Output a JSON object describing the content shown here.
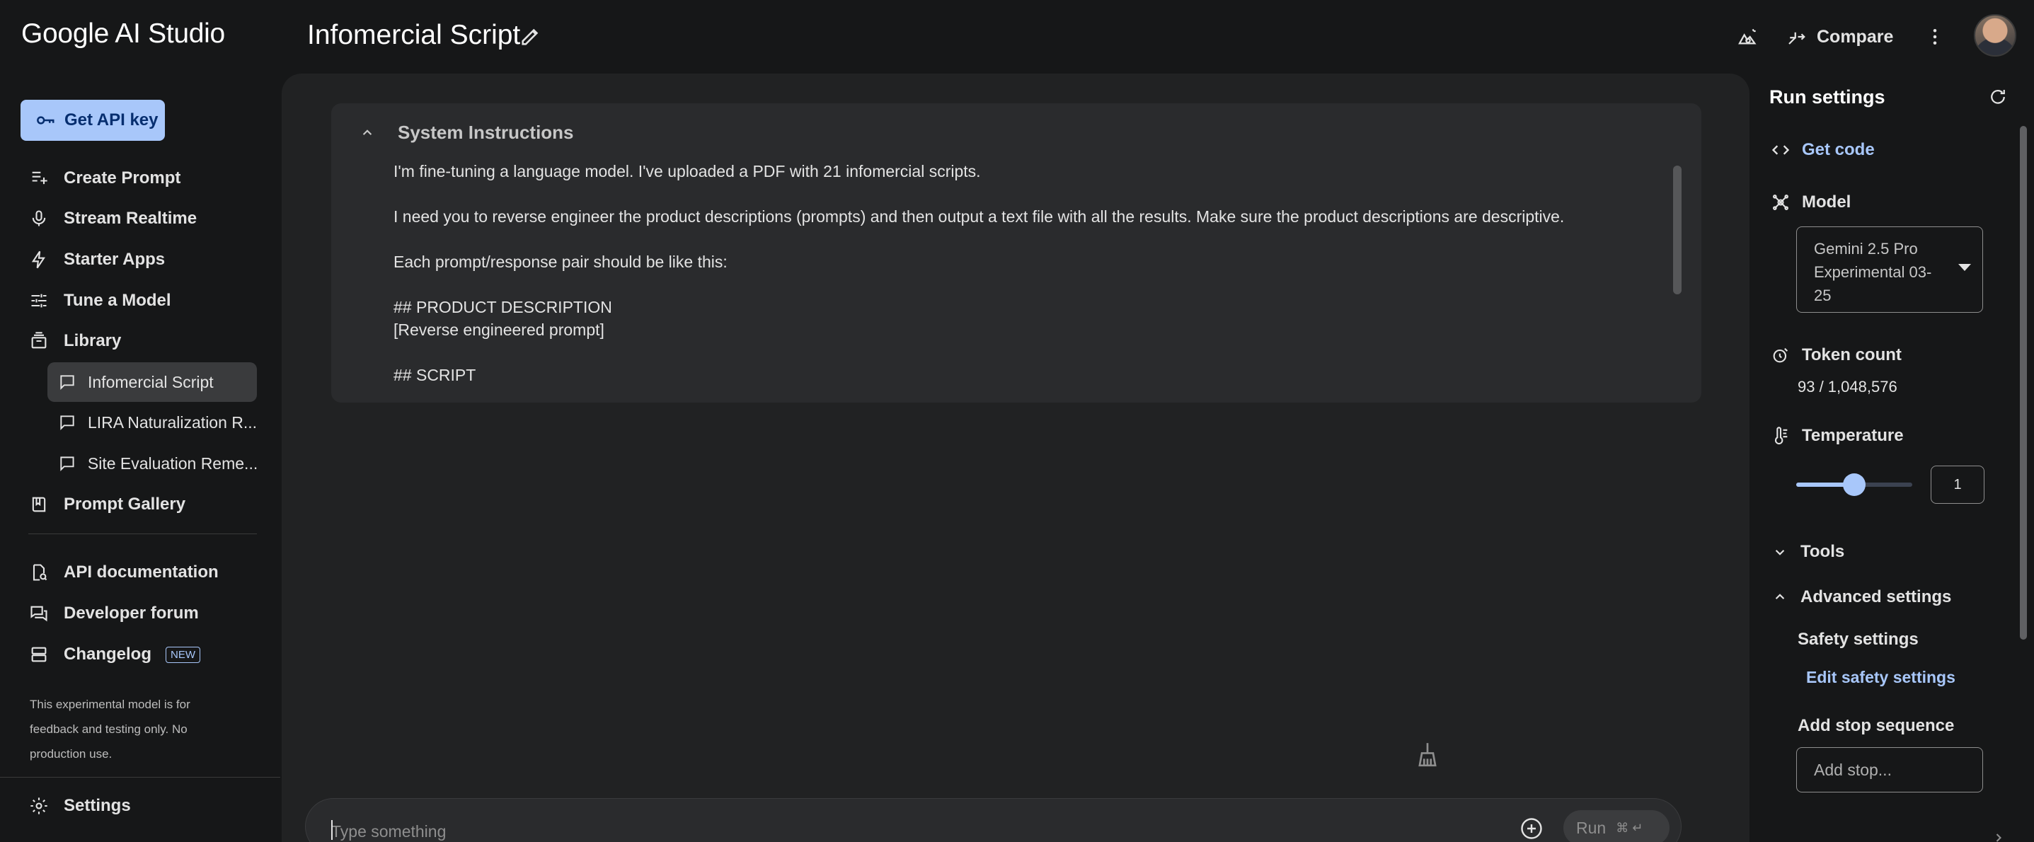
{
  "app": {
    "title": "Google AI Studio"
  },
  "header": {
    "prompt_title": "Infomercial Script",
    "compare_label": "Compare"
  },
  "sidebar": {
    "api_key_label": "Get API key",
    "nav": [
      {
        "label": "Create Prompt",
        "icon": "create-prompt-icon"
      },
      {
        "label": "Stream Realtime",
        "icon": "microphone-icon"
      },
      {
        "label": "Starter Apps",
        "icon": "bolt-icon"
      },
      {
        "label": "Tune a Model",
        "icon": "tune-icon"
      },
      {
        "label": "Library",
        "icon": "library-icon"
      }
    ],
    "library_items": [
      {
        "label": "Infomercial Script",
        "active": true
      },
      {
        "label": "LIRA Naturalization R..."
      },
      {
        "label": "Site Evaluation Reme..."
      }
    ],
    "prompt_gallery_label": "Prompt Gallery",
    "resources": [
      {
        "label": "API documentation",
        "icon": "api-doc-icon"
      },
      {
        "label": "Developer forum",
        "icon": "forum-icon"
      },
      {
        "label": "Changelog",
        "icon": "changelog-icon",
        "badge": "NEW"
      }
    ],
    "disclaimer": "This experimental model is for feedback and testing only. No production use.",
    "settings_label": "Settings"
  },
  "system_instructions": {
    "title": "System Instructions",
    "lines": [
      "I'm fine-tuning a language model. I've uploaded a PDF with 21 infomercial scripts.",
      "",
      "I need you to reverse engineer the product descriptions (prompts) and then output a text file with all the results. Make sure the product descriptions are descriptive.",
      "",
      "Each prompt/response pair should be like this:",
      "",
      "## PRODUCT DESCRIPTION",
      "[Reverse engineered prompt]",
      "",
      "## SCRIPT"
    ]
  },
  "composer": {
    "placeholder": "Type something",
    "run_label": "Run",
    "run_shortcut": "⌘ ↵"
  },
  "run_settings": {
    "title": "Run settings",
    "get_code_label": "Get code",
    "model_label": "Model",
    "model_value": "Gemini 2.5 Pro Experimental 03-25",
    "token_count_label": "Token count",
    "token_count_value": "93 / 1,048,576",
    "temperature_label": "Temperature",
    "temperature_value": "1",
    "temperature_fraction": 0.5,
    "tools_label": "Tools",
    "advanced_label": "Advanced settings",
    "safety_label": "Safety settings",
    "edit_safety_label": "Edit safety settings",
    "stop_sequence_label": "Add stop sequence",
    "stop_placeholder": "Add stop..."
  },
  "colors": {
    "accent": "#a8c7fa",
    "background": "#161718",
    "surface": "#212223",
    "card": "#2a2b2d"
  }
}
